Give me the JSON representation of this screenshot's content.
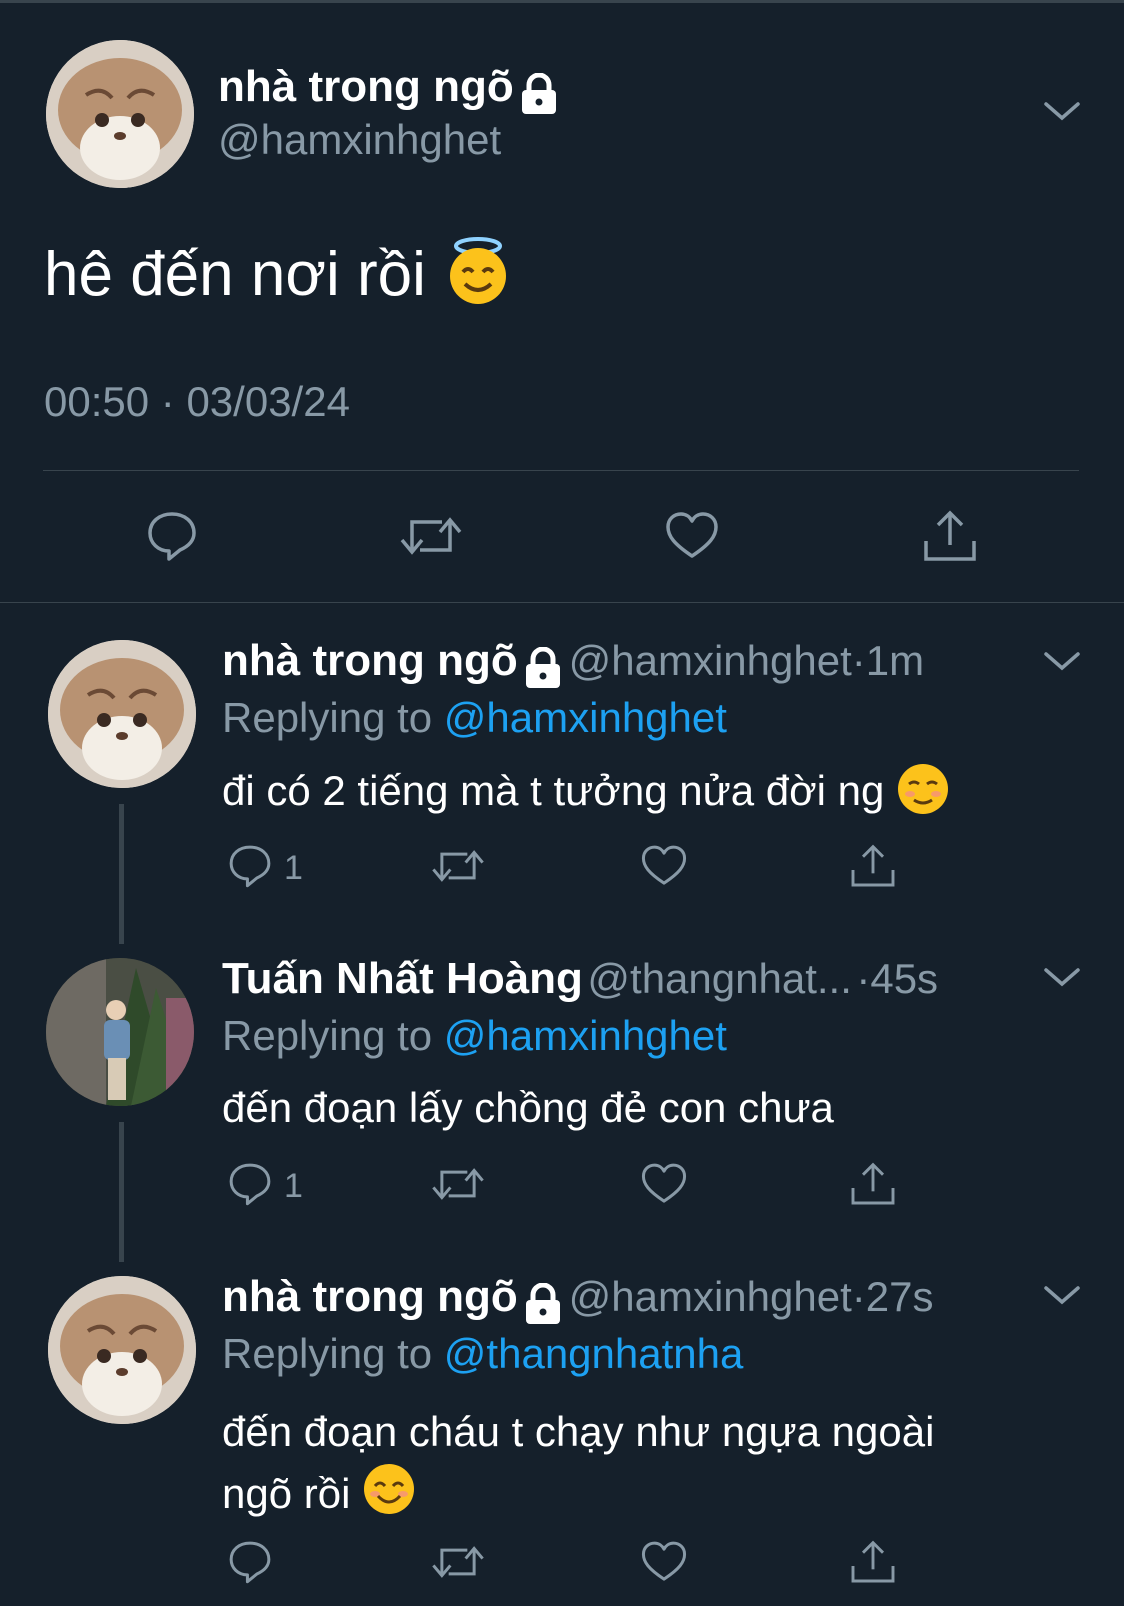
{
  "main_tweet": {
    "display_name": "nhà trong ngõ",
    "handle": "@hamxinhghet",
    "text": "hê đến nơi rồi",
    "emoji": "smiling-face-with-halo",
    "time": "00:50",
    "date": "03/03/24",
    "time_separator": "·"
  },
  "replies": [
    {
      "display_name": "nhà trong ngõ",
      "handle": "@hamxinhghet",
      "separator": "·",
      "age": "1m",
      "replying_label": "Replying to",
      "replying_to": "@hamxinhghet",
      "text": "đi có 2 tiếng mà t tưởng nửa đời ng",
      "emoji": "smiling-face",
      "reply_count": "1",
      "protected": true
    },
    {
      "display_name": "Tuấn Nhất Hoàng",
      "handle": "@thangnhat...",
      "separator": "·",
      "age": "45s",
      "replying_label": "Replying to",
      "replying_to": "@hamxinhghet",
      "text": "đến đoạn lấy chồng đẻ con chưa",
      "reply_count": "1",
      "protected": false
    },
    {
      "display_name": "nhà trong ngõ",
      "handle": "@hamxinhghet",
      "separator": "·",
      "age": "27s",
      "replying_label": "Replying to",
      "replying_to": "@thangnhatnha",
      "text_line1": "đến đoạn cháu t chạy như ngựa ngoài",
      "text_line2": "ngõ rồi",
      "emoji": "smiling-face-with-smiling-eyes",
      "protected": true
    }
  ],
  "icons": [
    "reply-icon",
    "retweet-icon",
    "like-icon",
    "share-icon",
    "lock-icon",
    "chevron-down-icon"
  ],
  "colors": {
    "background": "#15202b",
    "text": "#ffffff",
    "secondary": "#8899a6",
    "link": "#1da1f2",
    "divider": "#38444d"
  }
}
